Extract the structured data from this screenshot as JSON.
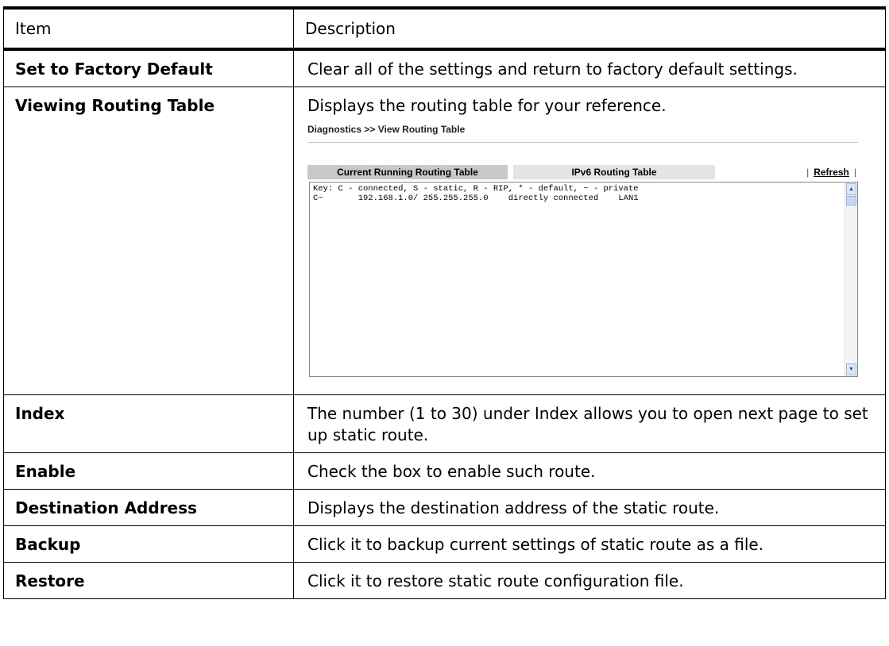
{
  "table": {
    "header": {
      "item": "Item",
      "description": "Description"
    },
    "rows": [
      {
        "item": "Set to Factory Default",
        "description": "Clear all of the settings and return to factory default settings."
      },
      {
        "item": "Viewing Routing Table",
        "description": "Displays the routing table for your reference."
      },
      {
        "item": "Index",
        "description": "The number (1 to 30) under Index allows you to open next page to set up static route."
      },
      {
        "item": "Enable",
        "description": "Check the box to enable such route."
      },
      {
        "item": "Destination Address",
        "description": "Displays the destination address of the static route."
      },
      {
        "item": "Backup",
        "description": "Click it to backup current settings of static route as a file."
      },
      {
        "item": "Restore",
        "description": "Click it to restore static route configuration file."
      }
    ]
  },
  "screenshot": {
    "breadcrumb": "Diagnostics >> View Routing Table",
    "tabs": [
      "Current Running Routing Table",
      "IPv6 Routing Table"
    ],
    "refresh_label": "Refresh",
    "separator": "|",
    "content": "Key: C - connected, S - static, R - RIP, * - default, ~ - private\nC~       192.168.1.0/ 255.255.255.0    directly connected    LAN1",
    "scroll_up_icon": "scroll-up-arrow",
    "scroll_down_icon": "scroll-down-arrow"
  }
}
